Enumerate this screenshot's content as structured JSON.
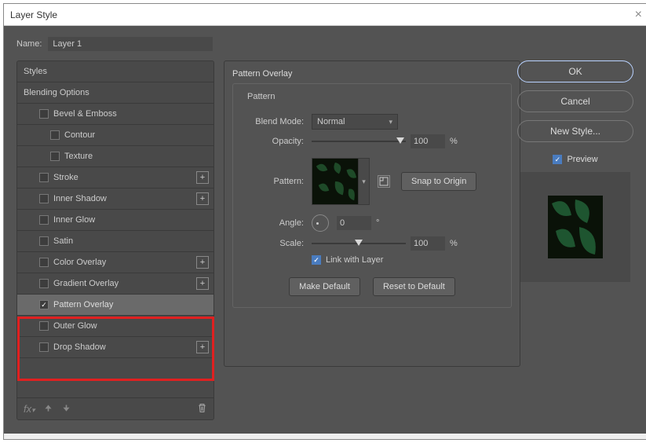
{
  "dialog": {
    "title": "Layer Style"
  },
  "header": {
    "name_label": "Name:",
    "layer_name": "Layer 1"
  },
  "styles": {
    "header": "Styles",
    "blending_options": "Blending Options",
    "bevel_emboss": "Bevel & Emboss",
    "contour": "Contour",
    "texture": "Texture",
    "stroke": "Stroke",
    "inner_shadow": "Inner Shadow",
    "inner_glow": "Inner Glow",
    "satin": "Satin",
    "color_overlay": "Color Overlay",
    "gradient_overlay": "Gradient Overlay",
    "pattern_overlay": "Pattern Overlay",
    "outer_glow": "Outer Glow",
    "drop_shadow": "Drop Shadow"
  },
  "panel": {
    "title": "Pattern Overlay",
    "group_title": "Pattern",
    "blend_mode_label": "Blend Mode:",
    "blend_mode_value": "Normal",
    "opacity_label": "Opacity:",
    "opacity_value": "100",
    "opacity_unit": "%",
    "pattern_label": "Pattern:",
    "snap_btn": "Snap to Origin",
    "angle_label": "Angle:",
    "angle_value": "0",
    "angle_unit": "°",
    "scale_label": "Scale:",
    "scale_value": "100",
    "scale_unit": "%",
    "link_label": "Link with Layer",
    "make_default": "Make Default",
    "reset_default": "Reset to Default"
  },
  "right": {
    "ok": "OK",
    "cancel": "Cancel",
    "new_style": "New Style...",
    "preview": "Preview"
  }
}
